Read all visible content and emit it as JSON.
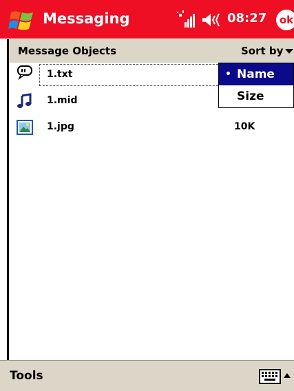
{
  "titlebar": {
    "app_title": "Messaging",
    "clock": "08:27",
    "ok_label": "ok",
    "icons": [
      "windows-start-icon",
      "signal-icon",
      "volume-icon"
    ]
  },
  "list_header": {
    "label": "Message Objects",
    "sort_label": "Sort by"
  },
  "items": [
    {
      "name": "1.txt",
      "size": "",
      "icon": "text-file-icon"
    },
    {
      "name": "1.mid",
      "size": "",
      "icon": "music-note-icon"
    },
    {
      "name": "1.jpg",
      "size": "10K",
      "icon": "image-file-icon"
    }
  ],
  "sort_menu": {
    "options": [
      "Name",
      "Size"
    ],
    "selected": "Name",
    "bullet": "•"
  },
  "bottombar": {
    "menu_label": "Tools",
    "icons": [
      "keyboard-icon",
      "input-panel-arrow-icon"
    ]
  },
  "colors": {
    "titlebar": "#ee0f24",
    "header_bar": "#dcd6c8",
    "selection": "#0a0a8a"
  }
}
